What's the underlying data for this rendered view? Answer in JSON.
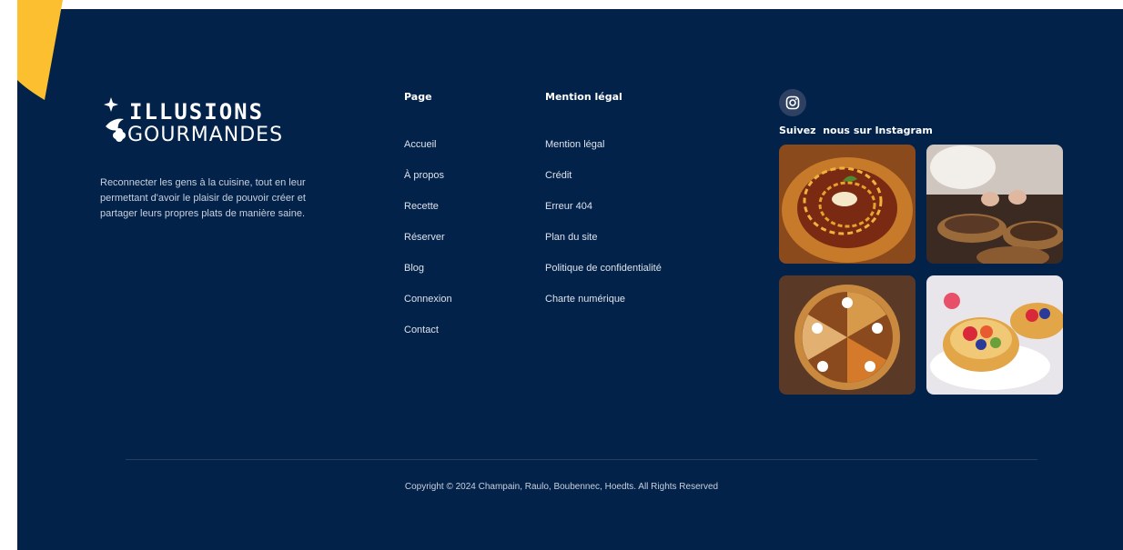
{
  "brand": {
    "logo_text": "ILLUSIONS GOURMANDES",
    "tagline": "Reconnecter les gens à la cuisine, tout en leur permettant d'avoir le plaisir de pouvoir créer et partager leurs propres plats de manière saine.",
    "accent_color": "#fbbf30",
    "footer_color": "#02224a"
  },
  "page_column": {
    "title": "Page",
    "links": [
      "Accueil",
      "À propos",
      "Recette",
      "Réserver",
      "Blog",
      "Connexion",
      "Contact"
    ]
  },
  "legal_column": {
    "title": "Mention légal",
    "links": [
      "Mention légal",
      "Crédit",
      "Erreur 404",
      "Plan du site",
      "Politique de confidentialité",
      "Charte numérique"
    ]
  },
  "instagram": {
    "icon": "instagram-icon",
    "title": "Suivez  nous sur Instagram",
    "photos": [
      "plated-dessert-photo",
      "chef-plating-photo",
      "pies-photo",
      "fruit-tarts-photo"
    ]
  },
  "footer": {
    "copyright": "Copyright © 2024 Champain, Raulo, Boubennec, Hoedts. All Rights Reserved"
  }
}
